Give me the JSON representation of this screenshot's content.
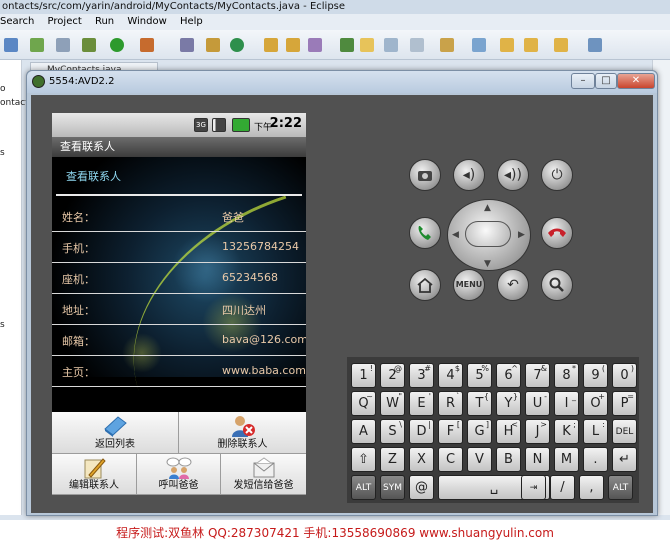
{
  "eclipse": {
    "title": "ontacts/src/com/yarin/android/MyContacts/MyContacts.java - Eclipse",
    "menu": [
      "Search",
      "Project",
      "Run",
      "Window",
      "Help"
    ],
    "editor_tab": "MyContacts.java",
    "left_fragments": [
      "o",
      "ontact",
      "s",
      "s"
    ]
  },
  "emulator": {
    "title": "5554:AVD2.2",
    "status": {
      "ampm": "下午",
      "time": "2:22",
      "net": "3G"
    },
    "app_title": "查看联系人",
    "heading": "查看联系人",
    "fields": [
      {
        "label": "姓名：",
        "value": "爸爸"
      },
      {
        "label": "手机：",
        "value": "13256784254"
      },
      {
        "label": "座机：",
        "value": "65234568"
      },
      {
        "label": "地址：",
        "value": "四川达州"
      },
      {
        "label": "邮箱：",
        "value": "bava@126.com"
      },
      {
        "label": "主页：",
        "value": "www.baba.com"
      }
    ],
    "menu": {
      "back": "返回列表",
      "delete": "删除联系人",
      "edit": "编辑联系人",
      "call": "呼叫爸爸",
      "sms": "发短信给爸爸"
    },
    "hw": {
      "menu": "MENU"
    },
    "keyboard": {
      "row1": [
        [
          "1",
          "!"
        ],
        [
          "2",
          "@"
        ],
        [
          "3",
          "#"
        ],
        [
          "4",
          "$"
        ],
        [
          "5",
          "%"
        ],
        [
          "6",
          "^"
        ],
        [
          "7",
          "&"
        ],
        [
          "8",
          "*"
        ],
        [
          "9",
          "("
        ],
        [
          "0",
          ")"
        ]
      ],
      "row2": [
        [
          "Q",
          "~"
        ],
        [
          "W",
          "\""
        ],
        [
          "E",
          "'"
        ],
        [
          "R",
          "`"
        ],
        [
          "T",
          "{"
        ],
        [
          "Y",
          "}"
        ],
        [
          "U",
          "-"
        ],
        [
          "I",
          "_"
        ],
        [
          "O",
          "+"
        ],
        [
          "P",
          "="
        ]
      ],
      "row3": [
        [
          "A",
          ""
        ],
        [
          "S",
          "\\"
        ],
        [
          "D",
          "|"
        ],
        [
          "F",
          "["
        ],
        [
          "G",
          "]"
        ],
        [
          "H",
          "<"
        ],
        [
          "J",
          ">"
        ],
        [
          "K",
          ";"
        ],
        [
          "L",
          ":"
        ],
        [
          "DEL",
          ""
        ]
      ],
      "row4": [
        [
          "⇧",
          ""
        ],
        [
          "Z",
          ""
        ],
        [
          "X",
          ""
        ],
        [
          "C",
          ""
        ],
        [
          "V",
          ""
        ],
        [
          "B",
          ""
        ],
        [
          "N",
          ""
        ],
        [
          "M",
          ""
        ],
        [
          ".",
          ""
        ],
        [
          "↵",
          ""
        ]
      ],
      "row5": {
        "alt_left": "ALT",
        "sym": "SYM",
        "at": "@",
        "space": "␣",
        "tab": "⇥",
        "slash": "/",
        "qmark": "?",
        "comma": ",",
        "alt_right": "ALT"
      }
    }
  },
  "footer": "程序测试:双鱼林 QQ:287307421 手机:13558690869 www.shuangyulin.com"
}
